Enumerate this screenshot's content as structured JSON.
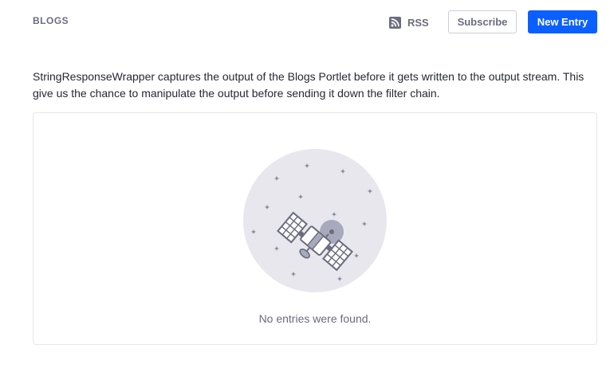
{
  "header": {
    "title": "BLOGS",
    "rss_label": "RSS",
    "rss_icon": "rss-icon",
    "subscribe_label": "Subscribe",
    "new_entry_label": "New Entry"
  },
  "intro_text": "StringResponseWrapper captures the output of the Blogs Portlet before it gets written to the output stream. This give us the chance to manipulate the output before sending it down the filter chain.",
  "empty_state": {
    "illustration": "satellite-icon",
    "message": "No entries were found."
  },
  "colors": {
    "primary": "#0b5fff",
    "secondary_text": "#6b6c7e",
    "body_text": "#272833",
    "border": "#e7e7ed"
  }
}
